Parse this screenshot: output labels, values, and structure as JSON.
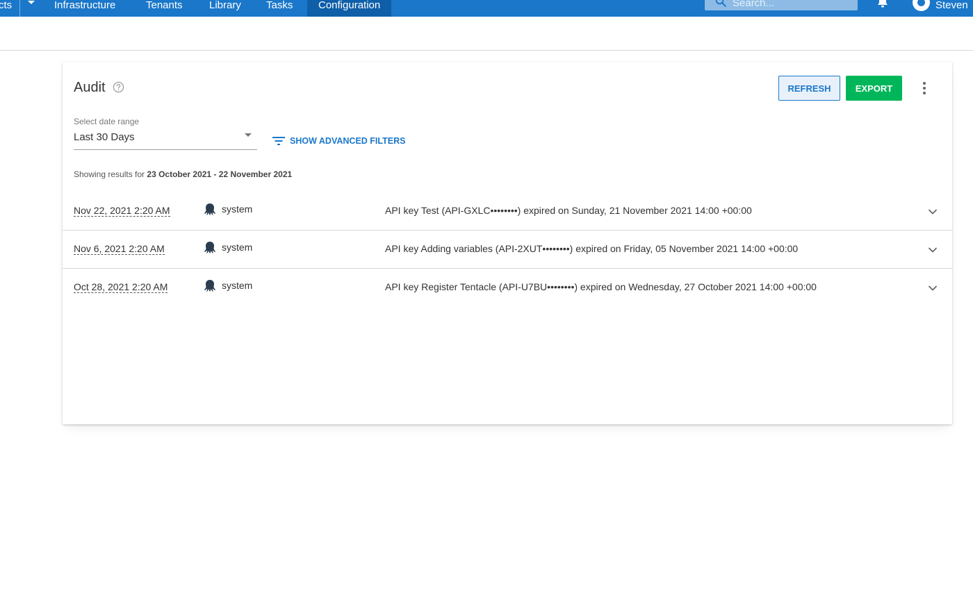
{
  "nav": {
    "partial_left": "cts",
    "items": [
      "Infrastructure",
      "Tenants",
      "Library",
      "Tasks",
      "Configuration"
    ],
    "active": "Configuration",
    "search_placeholder": "Search...",
    "username": "Steven"
  },
  "audit": {
    "title": "Audit",
    "refresh_label": "REFRESH",
    "export_label": "EXPORT",
    "date_range_label": "Select date range",
    "date_range_value": "Last 30 Days",
    "advanced_filters_label": "SHOW ADVANCED FILTERS",
    "results_prefix": "Showing results for ",
    "results_range": "23 October 2021 - 22 November 2021",
    "rows": [
      {
        "date": "Nov 22, 2021 2:20 AM",
        "user": "system",
        "message": "API key Test (API-GXLC••••••••) expired on Sunday, 21 November 2021 14:00 +00:00"
      },
      {
        "date": "Nov 6, 2021 2:20 AM",
        "user": "system",
        "message": "API key Adding variables (API-2XUT••••••••) expired on Friday, 05 November 2021 14:00 +00:00"
      },
      {
        "date": "Oct 28, 2021 2:20 AM",
        "user": "system",
        "message": "API key Register Tentacle (API-U7BU••••••••) expired on Wednesday, 27 October 2021 14:00 +00:00"
      }
    ]
  },
  "colors": {
    "brand_blue": "#1a77ca",
    "export_green": "#00b65a"
  },
  "icons": [
    "search-icon",
    "bell-icon",
    "help-icon",
    "filter-icon",
    "more-vert-icon",
    "octopus-icon",
    "chevron-down-icon"
  ]
}
